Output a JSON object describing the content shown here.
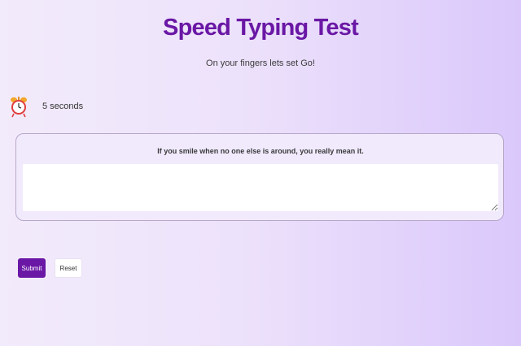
{
  "header": {
    "title": "Speed Typing Test",
    "subtitle": "On your fingers lets set Go!"
  },
  "timer": {
    "icon": "alarm-clock-icon",
    "text": "5 seconds"
  },
  "test": {
    "quote": "If you smile when no one else is around, you really mean it.",
    "input_value": "",
    "input_placeholder": ""
  },
  "actions": {
    "submit_label": "Submit",
    "reset_label": "Reset"
  },
  "colors": {
    "accent": "#6a17a5",
    "background_start": "#f2ebfb",
    "background_end": "#dac8fb",
    "card_background": "#f1eafd"
  }
}
